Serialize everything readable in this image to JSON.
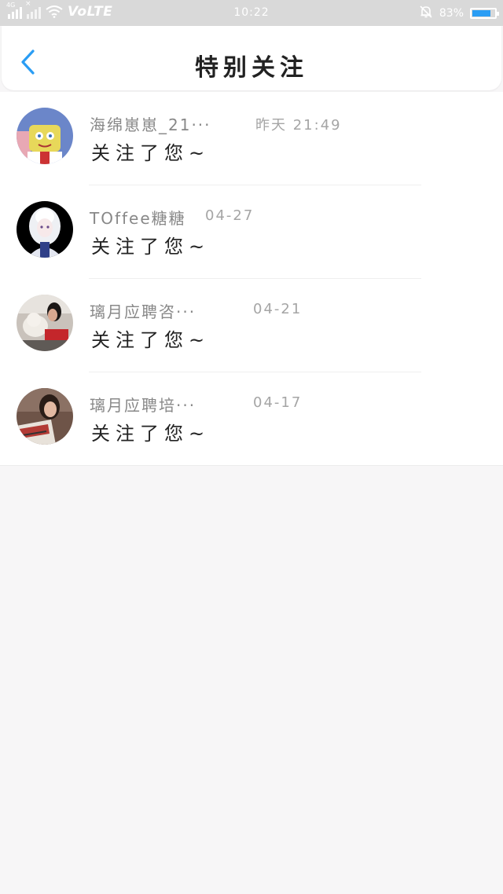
{
  "status_bar": {
    "network_tag": "4G",
    "carrier_label": "VoLTE",
    "time": "10:22",
    "battery_percent": "83%",
    "battery_level": 0.83
  },
  "header": {
    "title": "特别关注",
    "back_icon": "chevron-left-icon"
  },
  "notifications": [
    {
      "name": "海绵崽崽_21···",
      "time": "昨天 21:49",
      "message": "关注了您~"
    },
    {
      "name": "TOffee糖糖",
      "time": "04-27",
      "message": "关注了您~"
    },
    {
      "name": "璃月应聘咨···",
      "time": "04-21",
      "message": "关注了您~"
    },
    {
      "name": "璃月应聘培···",
      "time": "04-17",
      "message": "关注了您~"
    }
  ],
  "colors": {
    "accent": "#2a9df4",
    "background": "#f7f6f7",
    "status_bar": "#d9d9d9"
  }
}
